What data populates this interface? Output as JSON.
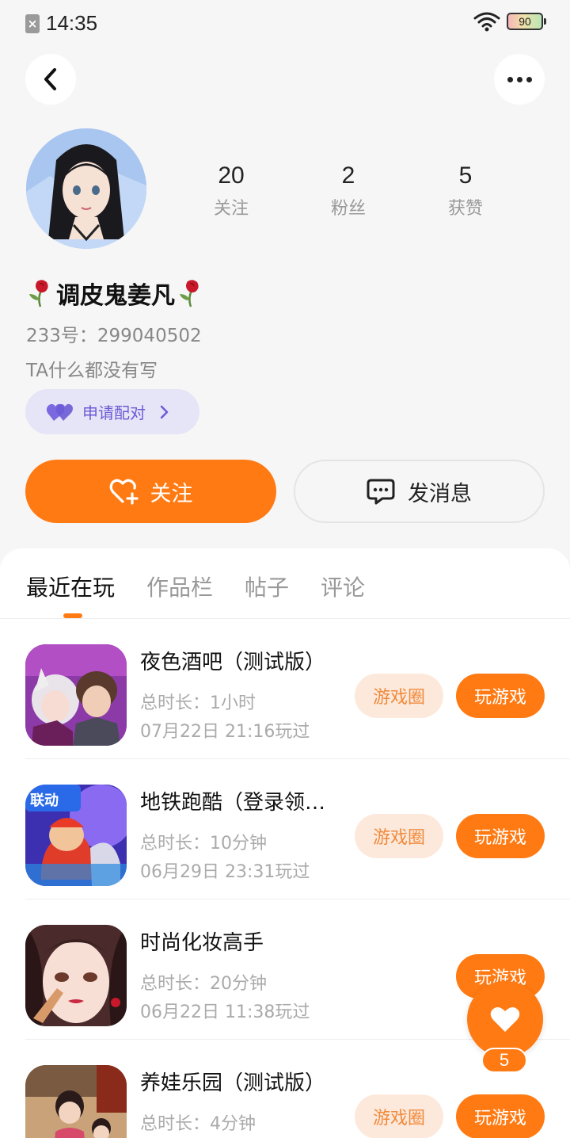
{
  "status_bar": {
    "time": "14:35",
    "battery": "90",
    "icons": [
      "sim-off-icon",
      "wifi-icon",
      "battery-icon"
    ]
  },
  "nav": {
    "back_icon": "chevron-left-icon",
    "more_icon": "more-dots-icon"
  },
  "profile": {
    "nickname": "调皮鬼姜凡",
    "id_line": "233号：299040502",
    "bio": "TA什么都没有写",
    "stats": [
      {
        "value": "20",
        "label": "关注"
      },
      {
        "value": "2",
        "label": "粉丝"
      },
      {
        "value": "5",
        "label": "获赞"
      }
    ],
    "pair_button": "申请配对",
    "follow_button": "关注",
    "message_button": "发消息"
  },
  "colors": {
    "accent": "#ff7a12",
    "pair": "#6b5bd6",
    "pair_bg": "#e6e4f7",
    "circle_bg": "#fde9db"
  },
  "tabs": [
    "最近在玩",
    "作品栏",
    "帖子",
    "评论"
  ],
  "active_tab": "最近在玩",
  "games": [
    {
      "name": "夜色酒吧（测试版）",
      "duration": "总时长：1小时",
      "last_played": "07月22日 21:16玩过",
      "circle_label": "游戏圈",
      "play_label": "玩游戏"
    },
    {
      "name": "地铁跑酷（登录领…",
      "duration": "总时长：10分钟",
      "last_played": "06月29日 23:31玩过",
      "circle_label": "游戏圈",
      "play_label": "玩游戏",
      "icon_badge": "联动"
    },
    {
      "name": "时尚化妆高手",
      "duration": "总时长：20分钟",
      "last_played": "06月22日 11:38玩过",
      "circle_label": "",
      "play_label": "玩游戏"
    },
    {
      "name": "养娃乐园（测试版）",
      "duration": "总时长：4分钟",
      "last_played": "",
      "circle_label": "游戏圈",
      "play_label": "玩游戏"
    }
  ],
  "floating_like": {
    "count": "5",
    "icon": "heart-icon"
  }
}
